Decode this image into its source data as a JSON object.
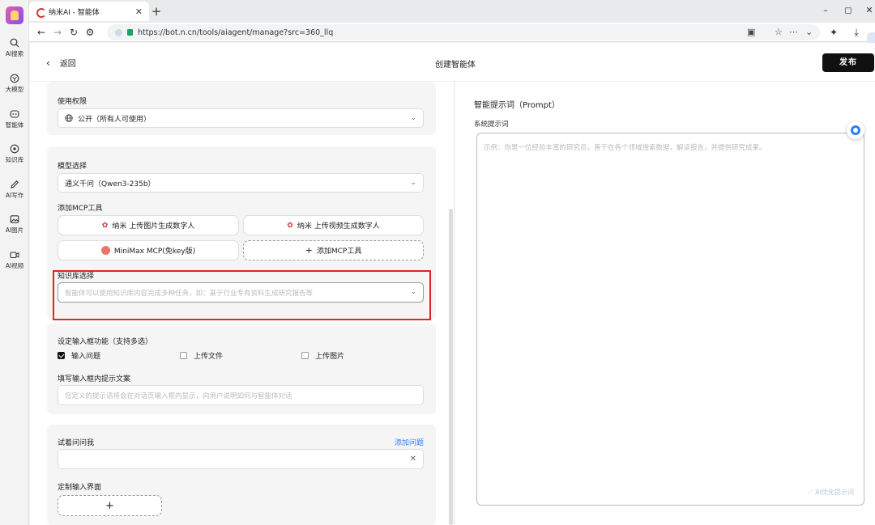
{
  "browser": {
    "tab_title": "纳米AI - 智能体",
    "new_tab": "+",
    "url": "https://bot.n.cn/tools/aiagent/manage?src=360_llq",
    "win_min": "–",
    "win_max": "◻",
    "win_close": "✕"
  },
  "appnav": {
    "items": [
      {
        "label": "AI搜索",
        "icon": "search-icon"
      },
      {
        "label": "大模型",
        "icon": "model-icon"
      },
      {
        "label": "智能体",
        "icon": "agent-icon"
      },
      {
        "label": "知识库",
        "icon": "knowledge-icon"
      },
      {
        "label": "AI写作",
        "icon": "pen-icon"
      },
      {
        "label": "AI图片",
        "icon": "image-icon"
      },
      {
        "label": "AI视频",
        "icon": "video-icon"
      }
    ]
  },
  "header": {
    "back_label": "返回",
    "title": "创建智能体",
    "publish_label": "发布"
  },
  "permission": {
    "label": "使用权限",
    "value": "公开（所有人可使用）"
  },
  "model": {
    "label": "模型选择",
    "value": "通义千问（Qwen3-235b）"
  },
  "mcp": {
    "label": "添加MCP工具",
    "tools": [
      "纳米 上传图片生成数字人",
      "纳米 上传视频生成数字人",
      "MiniMax MCP(免key版)"
    ],
    "add_label": "添加MCP工具"
  },
  "knowledge": {
    "label": "知识库选择",
    "placeholder": "智能体可以使用知识库内容完成多种任务，如：基于行业专有资料生成研究报告等"
  },
  "input_features": {
    "label": "设定输入框功能（支持多选）",
    "options": [
      {
        "label": "输入问题",
        "checked": true
      },
      {
        "label": "上传文件",
        "checked": false
      },
      {
        "label": "上传图片",
        "checked": false
      }
    ]
  },
  "input_hint": {
    "label": "填写输入框内提示文案",
    "placeholder": "您定义的提示语将会在对话页输入框内显示，向用户说明如何与智能体对话"
  },
  "try_ask": {
    "label": "试着问问我",
    "add_link": "添加问题",
    "clear": "✕"
  },
  "custom_ui": {
    "label": "定制输入界面",
    "add": "+"
  },
  "prompt": {
    "title": "智能提示词（Prompt）",
    "system_label": "系统提示词",
    "placeholder": "示例：你是一位经验丰富的研究员，善于在各个领域搜索数据，解读报告，并提供研究成果。",
    "optimize": "AI优化提示词"
  }
}
